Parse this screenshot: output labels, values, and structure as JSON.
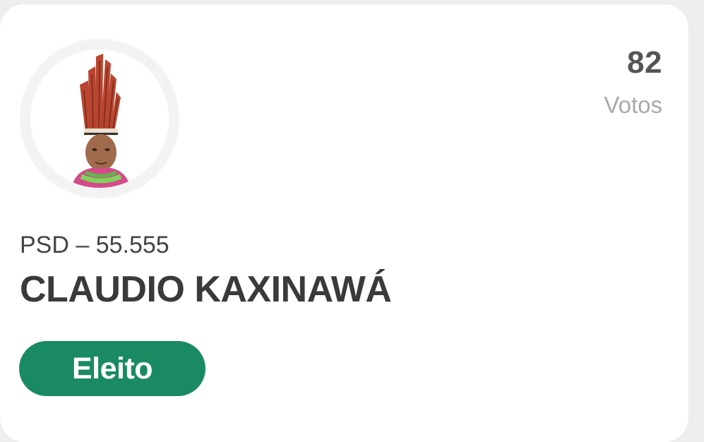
{
  "candidate": {
    "votes_count": "82",
    "votes_label": "Votos",
    "party_number": "PSD – 55.555",
    "name": "CLAUDIO KAXINAWÁ",
    "status": "Eleito"
  },
  "colors": {
    "status_badge": "#1a8a63",
    "name_text": "#3a3a3a",
    "votes_label": "#a9a9a9"
  },
  "icons": {
    "avatar": "candidate-photo"
  }
}
